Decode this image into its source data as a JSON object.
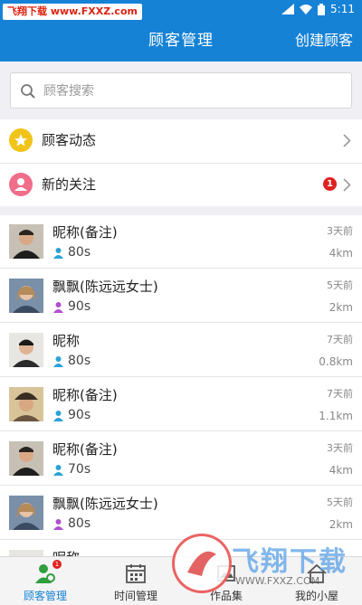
{
  "status_bar": {
    "watermark": "飞翔下载 www.FXXZ.com",
    "time": "5:11"
  },
  "nav": {
    "title": "顾客管理",
    "action": "创建顾客"
  },
  "search": {
    "placeholder": "顾客搜索"
  },
  "menu": {
    "items": [
      {
        "label": "顾客动态",
        "icon": "star-icon",
        "color": "#f0c419"
      },
      {
        "label": "新的关注",
        "icon": "person-icon",
        "color": "#f06e8a",
        "badge": "1"
      }
    ]
  },
  "customers": [
    {
      "name": "昵称(备注)",
      "age": "80s",
      "time": "3天前",
      "distance": "4km",
      "gender_color": "#2aa3d8"
    },
    {
      "name": "飘飘(陈远远女士)",
      "age": "90s",
      "time": "5天前",
      "distance": "2km",
      "gender_color": "#b04fd0"
    },
    {
      "name": "昵称",
      "age": "80s",
      "time": "7天前",
      "distance": "0.8km",
      "gender_color": "#2aa3d8"
    },
    {
      "name": "昵称(备注)",
      "age": "90s",
      "time": "7天前",
      "distance": "1.1km",
      "gender_color": "#2aa3d8"
    },
    {
      "name": "昵称(备注)",
      "age": "70s",
      "time": "3天前",
      "distance": "4km",
      "gender_color": "#2aa3d8"
    },
    {
      "name": "飘飘(陈远远女士)",
      "age": "80s",
      "time": "5天前",
      "distance": "2km",
      "gender_color": "#b04fd0"
    },
    {
      "name": "昵称",
      "age": "",
      "time": "",
      "distance": "",
      "gender_color": "#2aa3d8"
    }
  ],
  "tabs": [
    {
      "label": "顾客管理",
      "active": true,
      "badge": "1"
    },
    {
      "label": "时间管理",
      "active": false
    },
    {
      "label": "作品集",
      "active": false
    },
    {
      "label": "我的小屋",
      "active": false
    }
  ],
  "watermark_logo": {
    "big": "飞翔下载",
    "small": "WWW.FXXZ.COM"
  },
  "colors": {
    "primary": "#1582d6",
    "badge": "#e02020"
  }
}
